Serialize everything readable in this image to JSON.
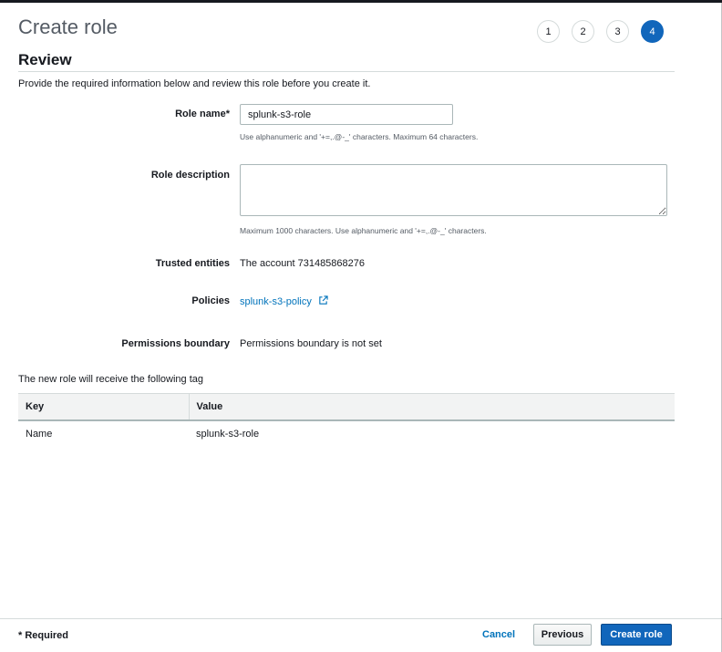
{
  "header": {
    "title": "Create role",
    "steps": [
      "1",
      "2",
      "3",
      "4"
    ],
    "active_step": "4"
  },
  "review": {
    "section_title": "Review",
    "intro": "Provide the required information below and review this role before you create it."
  },
  "form": {
    "role_name_label": "Role name*",
    "role_name_value": "splunk-s3-role",
    "role_name_hint": "Use alphanumeric and '+=,.@-_' characters. Maximum 64 characters.",
    "role_description_label": "Role description",
    "role_description_value": "",
    "role_description_hint": "Maximum 1000 characters. Use alphanumeric and '+=,.@-_' characters.",
    "trusted_entities_label": "Trusted entities",
    "trusted_entities_value": "The account 731485868276",
    "policies_label": "Policies",
    "policies_link": "splunk-s3-policy",
    "permissions_boundary_label": "Permissions boundary",
    "permissions_boundary_value": "Permissions boundary is not set"
  },
  "tags": {
    "caption": "The new role will receive the following tag",
    "columns": [
      "Key",
      "Value"
    ],
    "rows": [
      {
        "key": "Name",
        "value": "splunk-s3-role"
      }
    ]
  },
  "footer": {
    "required_note": "* Required",
    "cancel_label": "Cancel",
    "previous_label": "Previous",
    "create_label": "Create role"
  },
  "colors": {
    "primary": "#1166bb",
    "link": "#0073bb",
    "border": "#d5dbdb",
    "header_bg": "#f2f3f3"
  },
  "icons": {
    "policy_link": "external-link-icon"
  }
}
